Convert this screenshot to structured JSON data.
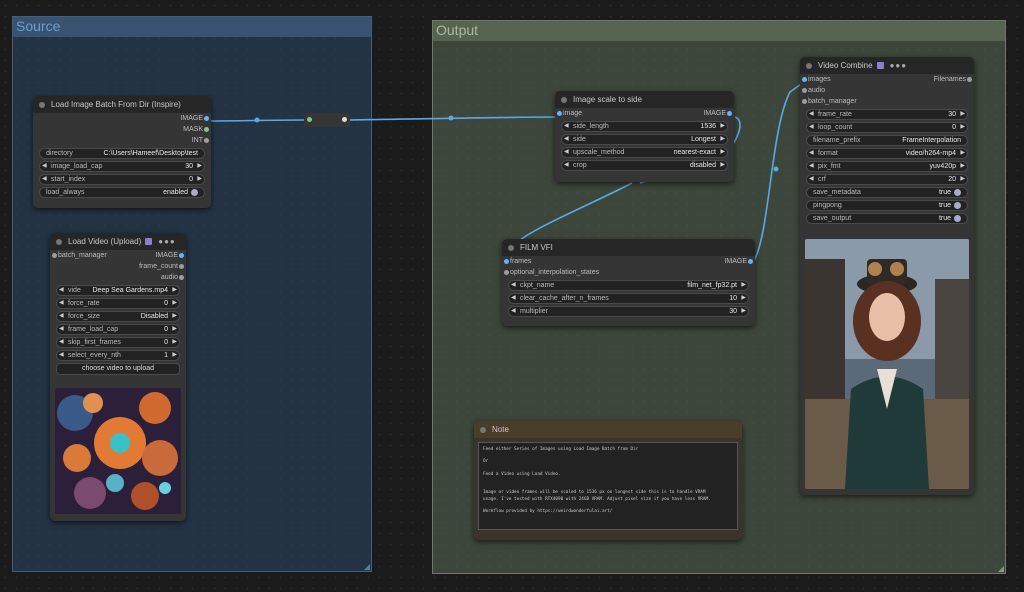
{
  "groups": {
    "source": "Source",
    "output": "Output"
  },
  "load_batch": {
    "title": "Load Image Batch From Dir (Inspire)",
    "outputs": [
      "IMAGE",
      "MASK",
      "INT"
    ],
    "directory": {
      "k": "directory",
      "v": "C:\\Users\\Hameef\\Desktop\\test"
    },
    "image_load_cap": {
      "k": "image_load_cap",
      "v": "30"
    },
    "start_index": {
      "k": "start_index",
      "v": "0"
    },
    "load_always": {
      "k": "load_always",
      "v": "enabled"
    }
  },
  "load_video": {
    "title": "Load Video (Upload)",
    "input": "batch_manager",
    "outputs": [
      "IMAGE",
      "frame_count",
      "audio"
    ],
    "video": {
      "k": "vide",
      "v": "Deep Sea Gardens.mp4"
    },
    "force_rate": {
      "k": "force_rate",
      "v": "0"
    },
    "force_size": {
      "k": "force_size",
      "v": "Disabled"
    },
    "frame_load_cap": {
      "k": "frame_load_cap",
      "v": "0"
    },
    "skip_first_frames": {
      "k": "skip_first_frames",
      "v": "0"
    },
    "select_every_nth": {
      "k": "select_every_nth",
      "v": "1"
    },
    "upload": "choose video to upload"
  },
  "scale": {
    "title": "Image scale to side",
    "input": "image",
    "output": "IMAGE",
    "side_length": {
      "k": "side_length",
      "v": "1536"
    },
    "side": {
      "k": "side",
      "v": "Longest"
    },
    "upscale_method": {
      "k": "upscale_method",
      "v": "nearest-exact"
    },
    "crop": {
      "k": "crop",
      "v": "disabled"
    }
  },
  "film": {
    "title": "FILM VFI",
    "inputs": [
      "frames",
      "optional_interpolation_states"
    ],
    "output": "IMAGE",
    "ckpt_name": {
      "k": "ckpt_name",
      "v": "film_net_fp32.pt"
    },
    "clear_cache": {
      "k": "clear_cache_after_n_frames",
      "v": "10"
    },
    "multiplier": {
      "k": "multiplier",
      "v": "30"
    }
  },
  "combine": {
    "title": "Video Combine",
    "inputs": [
      "images",
      "audio",
      "batch_manager"
    ],
    "output": "Filenames",
    "frame_rate": {
      "k": "frame_rate",
      "v": "30"
    },
    "loop_count": {
      "k": "loop_count",
      "v": "0"
    },
    "filename_prefix": {
      "k": "filename_prefix",
      "v": "FrameInterpolation"
    },
    "format": {
      "k": "format",
      "v": "video/h264-mp4"
    },
    "pix_fmt": {
      "k": "pix_fmt",
      "v": "yuv420p"
    },
    "crf": {
      "k": "crf",
      "v": "20"
    },
    "save_metadata": {
      "k": "save_metadata",
      "v": "true"
    },
    "pingpong": {
      "k": "pingpong",
      "v": "true"
    },
    "save_output": {
      "k": "save_output",
      "v": "true"
    }
  },
  "note": {
    "title": "Note",
    "text": "Feed either Series of Images using Load Image Batch from Dir\n\nOr\n\nFeed a Video using Load Video.\n\n\nImage or video frames will be scaled to 1536 px on longest side this is to handle VRAM\nusage. I've tested with RTX4090 with 24GB VRAM. Adjust pixel size if you have less VRAM.\n\nWorkflow provided by https://weirdwonderfulai.art/"
  },
  "colors": {
    "image_pin": "#64b5f6",
    "mask_pin": "#81c784",
    "int_pin": "#9e9e9e",
    "wire": "#5aa9e6"
  }
}
